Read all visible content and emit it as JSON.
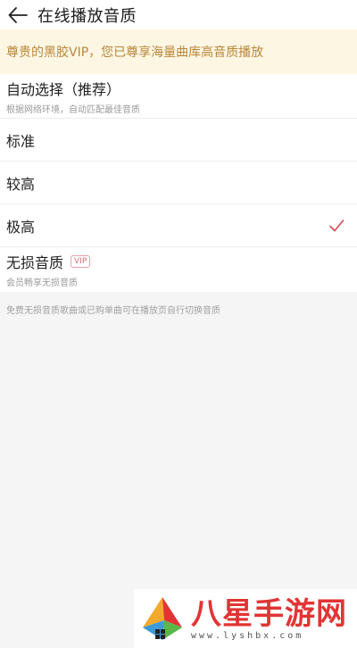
{
  "header": {
    "title": "在线播放音质",
    "back_icon": "arrow-left-icon"
  },
  "vip_banner": {
    "text": "尊贵的黑胶VIP，您已尊享海量曲库高音质播放",
    "color": "#b8863a"
  },
  "options": [
    {
      "label": "自动选择（推荐）",
      "sub": "根据网络环境，自动匹配最佳音质",
      "selected": false
    },
    {
      "label": "标准",
      "sub": "",
      "selected": false
    },
    {
      "label": "较高",
      "sub": "",
      "selected": false
    },
    {
      "label": "极高",
      "sub": "",
      "selected": true
    },
    {
      "label": "无损音质",
      "sub": "会员畅享无损音质",
      "badge": "VIP",
      "selected": false
    }
  ],
  "footnote": "免费无损音质歌曲或已购单曲可在播放页自行切换音质",
  "watermark": {
    "name": "八星手游网",
    "url": "www.lyshbx.com"
  },
  "colors": {
    "check": "#d24a52",
    "vip_tag": "#d8707c"
  }
}
